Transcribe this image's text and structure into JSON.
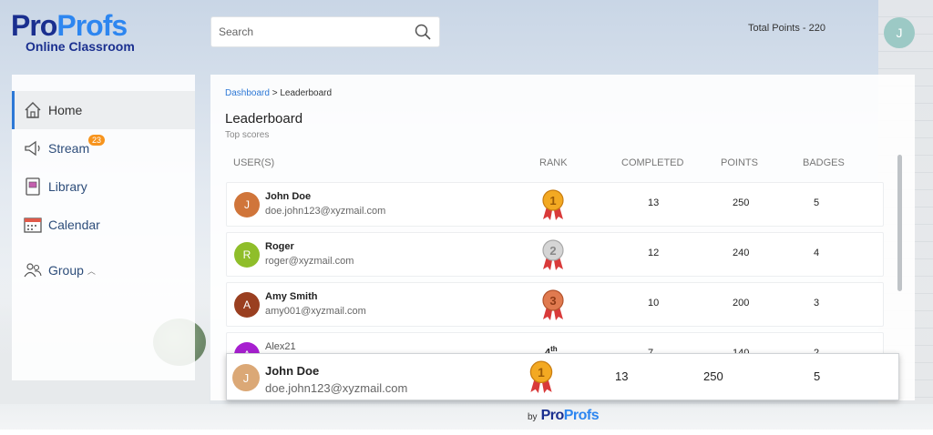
{
  "brand": {
    "logo_pro": "Pro",
    "logo_profs": "Profs",
    "logo_sub": "Online Classroom"
  },
  "header": {
    "search_placeholder": "Search",
    "total_points": "Total Points - 220",
    "user_initial": "J"
  },
  "sidebar": {
    "items": [
      {
        "label": "Home",
        "icon": "home-icon"
      },
      {
        "label": "Stream",
        "icon": "megaphone-icon",
        "badge": "23"
      },
      {
        "label": "Library",
        "icon": "book-icon"
      },
      {
        "label": "Calendar",
        "icon": "calendar-icon"
      },
      {
        "label": "Group",
        "icon": "group-icon"
      }
    ]
  },
  "main": {
    "breadcrumb_root": "Dashboard",
    "breadcrumb_sep": " > ",
    "breadcrumb_current": "Leaderboard",
    "title": "Leaderboard",
    "subtitle": "Top scores",
    "columns": {
      "user": "USER(S)",
      "rank": "RANK",
      "completed": "COMPLETED",
      "points": "POINTS",
      "badges": "BADGES"
    },
    "rows": [
      {
        "initial": "J",
        "name": "John Doe",
        "email": "doe.john123@xyzmail.com",
        "rank": "1",
        "completed": "13",
        "points": "250",
        "badges": "5",
        "avatar_color": "#d0753a"
      },
      {
        "initial": "R",
        "name": "Roger",
        "email": "roger@xyzmail.com",
        "rank": "2",
        "completed": "12",
        "points": "240",
        "badges": "4",
        "avatar_color": "#8fbe2a"
      },
      {
        "initial": "A",
        "name": "Amy Smith",
        "email": "amy001@xyzmail.com",
        "rank": "3",
        "completed": "10",
        "points": "200",
        "badges": "3",
        "avatar_color": "#9a3f20"
      },
      {
        "initial": "A",
        "name": "Alex21",
        "email": "",
        "rank": "4",
        "rank_suffix": "th",
        "completed": "7",
        "points": "140",
        "badges": "2",
        "avatar_color": "#a71fd0"
      }
    ],
    "current_user": {
      "initial": "J",
      "name": "John Doe",
      "email": "doe.john123@xyzmail.com",
      "rank": "1",
      "completed": "13",
      "points": "250",
      "badges": "5",
      "avatar_color": "#dba876"
    }
  },
  "footer": {
    "by": "by",
    "brand_pro": "Pro",
    "brand_profs": "Profs"
  },
  "colors": {
    "gold": "#f3a922",
    "silver": "#c9c9c9",
    "bronze": "#e07a4f",
    "ribbon": "#d93a3a",
    "accent": "#2d78d6"
  }
}
